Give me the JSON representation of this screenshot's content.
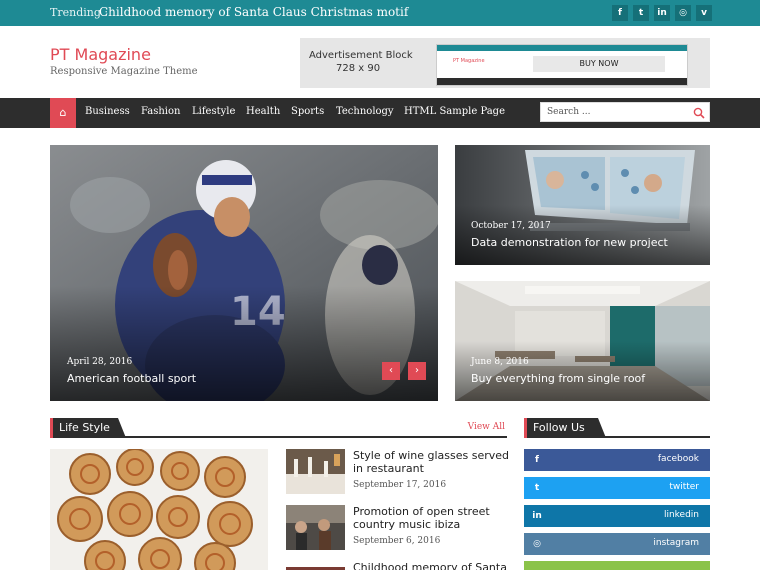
{
  "trending": {
    "label": "Trending :",
    "text": "Childhood memory of Santa Claus Christmas motif"
  },
  "top_social": [
    {
      "icon": "facebook-icon",
      "glyph": "f"
    },
    {
      "icon": "twitter-icon",
      "glyph": "t"
    },
    {
      "icon": "linkedin-icon",
      "glyph": "in"
    },
    {
      "icon": "instagram-icon",
      "glyph": "◎"
    },
    {
      "icon": "vimeo-icon",
      "glyph": "v"
    }
  ],
  "header": {
    "site_title": "PT Magazine",
    "tagline": "Responsive Magazine Theme",
    "ad_line1": "Advertisement Block",
    "ad_line2": "728 x 90",
    "ad_preview_cta": "BUY NOW"
  },
  "nav": {
    "home_glyph": "⌂",
    "items": [
      "Business",
      "Fashion",
      "Lifestyle",
      "Health",
      "Sports",
      "Technology",
      "HTML Sample Page"
    ],
    "search_placeholder": "Search ..."
  },
  "hero": {
    "date": "April 28, 2016",
    "title": "American football sport",
    "prev_glyph": "‹",
    "next_glyph": "›"
  },
  "features": [
    {
      "date": "October 17, 2017",
      "title": "Data demonstration for new project"
    },
    {
      "date": "June 8, 2016",
      "title": "Buy everything from single roof"
    }
  ],
  "lifestyle": {
    "heading": "Life Style",
    "view_all": "View All",
    "posts": [
      {
        "title": "Style of wine glasses served in restaurant",
        "date": "September 17, 2016"
      },
      {
        "title": "Promotion of open street country music ibiza",
        "date": "September 6, 2016"
      },
      {
        "title": "Childhood memory of Santa"
      }
    ]
  },
  "follow": {
    "heading": "Follow Us",
    "buttons": [
      {
        "label": "facebook",
        "glyph": "f",
        "color": "#3b5998",
        "icon_bg": "#2f4779"
      },
      {
        "label": "twitter",
        "glyph": "t",
        "color": "#1da1f2",
        "icon_bg": "#1789cf"
      },
      {
        "label": "linkedin",
        "glyph": "in",
        "color": "#0e76a8",
        "icon_bg": "#0b5f88"
      },
      {
        "label": "instagram",
        "glyph": "◎",
        "color": "#517fa4",
        "icon_bg": "#416886"
      }
    ]
  },
  "colors": {
    "topbar": "#1e8a94",
    "accent": "#e04a55",
    "nav": "#2d2d2d"
  }
}
